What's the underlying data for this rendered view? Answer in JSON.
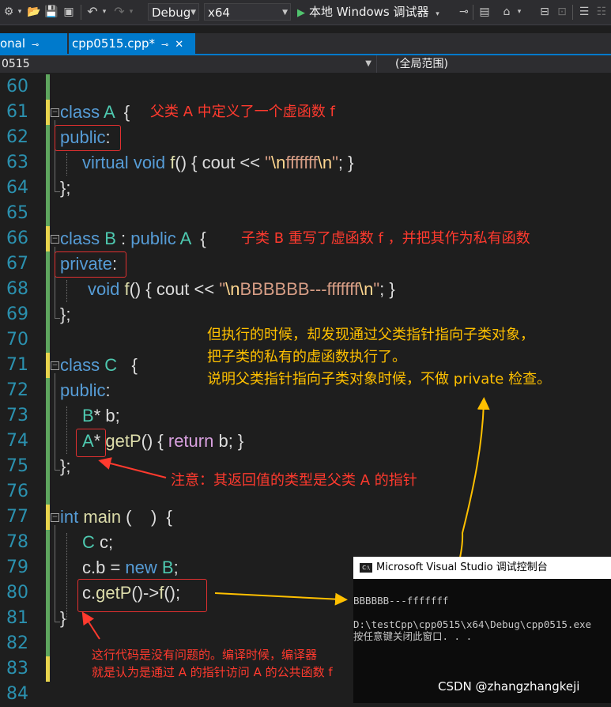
{
  "toolbar": {
    "config_combo": "Debug",
    "platform_combo": "x64",
    "run_label": "本地 Windows 调试器"
  },
  "tabs": [
    {
      "label": "onal"
    },
    {
      "label": "cpp0515.cpp*"
    }
  ],
  "nav": {
    "left_combo": "0515",
    "scope_combo": "(全局范围)"
  },
  "line_numbers": [
    "60",
    "61",
    "62",
    "63",
    "64",
    "65",
    "66",
    "67",
    "68",
    "69",
    "70",
    "71",
    "72",
    "73",
    "74",
    "75",
    "76",
    "77",
    "78",
    "79",
    "80",
    "81",
    "82",
    "83",
    "84"
  ],
  "code": {
    "l61": {
      "kw": "class",
      "name": "A",
      "brace": "{"
    },
    "l62": {
      "kw": "public",
      "colon": ":"
    },
    "l63": {
      "kw1": "virtual",
      "kw2": "void",
      "fn": "f",
      "p1": "() { cout << ",
      "q1": "\"",
      "esc1": "\\n",
      "str": "fffffff",
      "esc2": "\\n",
      "q2": "\"",
      "end": "; }"
    },
    "l64": "};",
    "l66": {
      "kw": "class",
      "name": "B",
      "mid": " : ",
      "kw2": "public",
      "base": "A",
      "brace": "{"
    },
    "l67": {
      "kw": "private",
      "colon": ":"
    },
    "l68": {
      "kw": "void",
      "fn": "f",
      "p1": "() { cout << ",
      "q1": "\"",
      "esc1": "\\n",
      "str": "BBBBBB---fffffff",
      "esc2": "\\n",
      "q2": "\"",
      "end": "; }"
    },
    "l69": "};",
    "l71": {
      "kw": "class",
      "name": "C",
      "brace": "{"
    },
    "l72": {
      "kw": "public",
      "colon": ":"
    },
    "l73": {
      "ty": "B",
      "rest": "* b;"
    },
    "l74": {
      "ty": "A",
      "star": "*",
      "fn": "getP",
      "p1": "() { ",
      "kw": "return",
      "end": " b; }"
    },
    "l75": "};",
    "l77": {
      "kw": "int",
      "fn": "main",
      "rest": " (    )  {"
    },
    "l78": {
      "ty": "C",
      "rest": " c;"
    },
    "l79": {
      "p1": "c.b = ",
      "kw": "new",
      "ty": "B",
      "end": ";"
    },
    "l80": {
      "p1": "c.",
      "fn": "getP",
      "p2": "()->",
      "fn2": "f",
      "end": "();"
    },
    "l81": "}"
  },
  "annotations": {
    "a61": "父类 A 中定义了一个虚函数 f",
    "a66": "子类 B 重写了虚函数 f ，并把其作为私有函数",
    "a_exec": [
      "但执行的时候，却发现通过父类指针指向子类对象，",
      "把子类的私有的虚函数执行了。",
      "说明父类指针指向子类对象时候，不做 private 检查。"
    ],
    "a75": "注意：其返回值的类型是父类 A 的指针",
    "a_bottom": [
      "这行代码是没有问题的。编译时候，编译器",
      "就是认为是通过 A 的指针访问 A 的公共函数 f"
    ]
  },
  "console": {
    "title": "Microsoft Visual Studio 调试控制台",
    "icon_text": "C:\\",
    "lines": [
      "BBBBBB---fffffff",
      "",
      "D:\\testCpp\\cpp0515\\x64\\Debug\\cpp0515.exe",
      "按任意键关闭此窗口. . ."
    ]
  },
  "watermark": "CSDN @zhangzhangkeji",
  "colors": {
    "keyword": "#569cd6",
    "type": "#4ec9b0",
    "function": "#dcdcaa",
    "string": "#d69d85",
    "escape": "#ffd68f",
    "annotation_red": "#ff3a2e",
    "annotation_yellow": "#ffc000",
    "accent": "#007acc"
  }
}
